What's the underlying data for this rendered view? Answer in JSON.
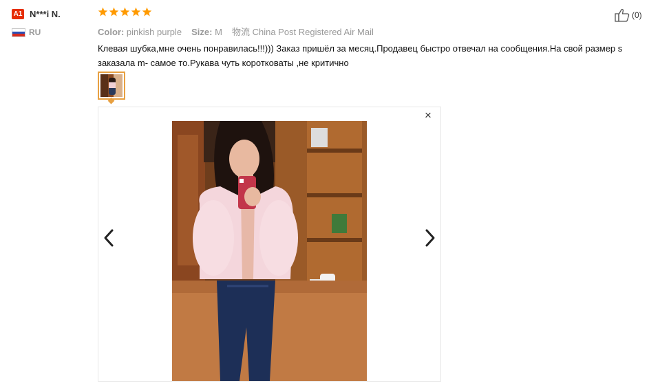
{
  "reviewer": {
    "badge": "A1",
    "name": "N***i N.",
    "country": "RU",
    "flag_colors": [
      "#ffffff",
      "#2a4fb5",
      "#d52b1e"
    ]
  },
  "review": {
    "rating": 5,
    "star_color": "#ff9a00",
    "color_label": "Color:",
    "color_value": "pinkish purple",
    "size_label": "Size:",
    "size_value": "M",
    "shipping_label": "物流",
    "shipping_value": "China Post Registered Air Mail",
    "text": "Клевая шубка,мне очень понравилась!!!))) Заказ пришёл за месяц.Продавец быстро отвечал на сообщения.На свой размер s заказала m- самое то.Рукава чуть коротковаты ,не критично",
    "helpful_count": "(0)"
  },
  "viewer": {
    "close_glyph": "×",
    "prev_icon": "chevron-left-icon",
    "next_icon": "chevron-right-icon"
  },
  "colors": {
    "badge": "#e62e04",
    "thumb_border": "#e8a041",
    "muted_text": "#999999"
  }
}
